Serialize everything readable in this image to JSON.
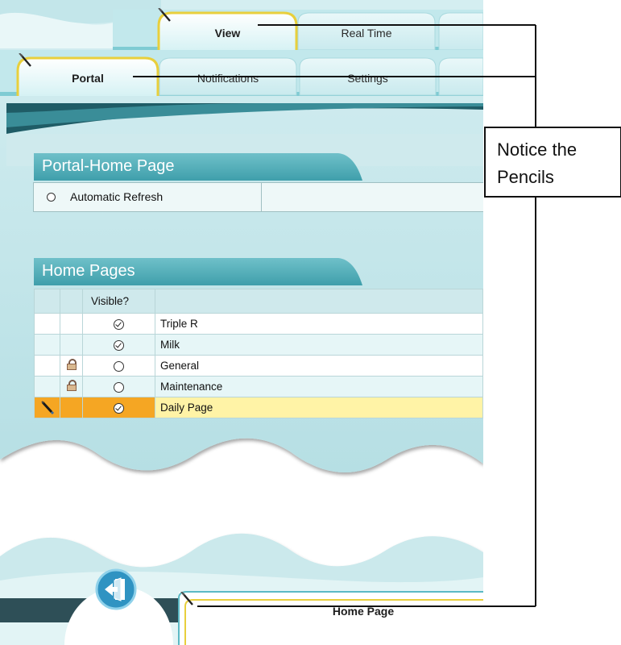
{
  "top_tabs": [
    {
      "label": "View",
      "active": true
    },
    {
      "label": "Real Time",
      "active": false
    }
  ],
  "sub_tabs": [
    {
      "label": "Portal",
      "active": true
    },
    {
      "label": "Notifications",
      "active": false
    },
    {
      "label": "Settings",
      "active": false
    }
  ],
  "portal_section": {
    "header": "Portal-Home Page",
    "auto_refresh_label": "Automatic Refresh"
  },
  "home_pages_section": {
    "header": "Home Pages",
    "columns": [
      "",
      "",
      "Visible?",
      ""
    ],
    "rows": [
      {
        "name": "Triple R",
        "visible": true,
        "locked": false,
        "editing": false
      },
      {
        "name": "Milk",
        "visible": true,
        "locked": false,
        "editing": false
      },
      {
        "name": "General",
        "visible": false,
        "locked": true,
        "editing": false
      },
      {
        "name": "Maintenance",
        "visible": false,
        "locked": true,
        "editing": false
      },
      {
        "name": "Daily Page",
        "visible": true,
        "locked": false,
        "editing": true
      }
    ]
  },
  "bottom_tab": {
    "label": "Home Page"
  },
  "callout": {
    "text": "Notice the\nPencils"
  },
  "icons": {
    "pencil": "pencil-icon",
    "lock": "lock-icon",
    "exit": "exit-door-icon",
    "check": "check-circle-icon",
    "radio": "radio-empty-icon"
  },
  "colors": {
    "teal_header": "#4aa9b4",
    "selected_row": "#fff3a6",
    "selected_marker": "#f5a623",
    "tab_gold": "#e8cf3c"
  }
}
